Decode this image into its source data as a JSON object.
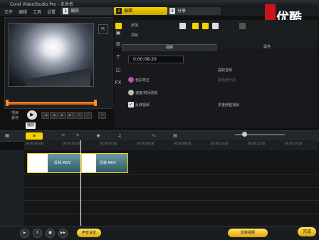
{
  "window": {
    "title": "Corel VideoStudio Pro - 未命名"
  },
  "menu": [
    "文件",
    "编辑",
    "工具",
    "设置"
  ],
  "steps": [
    {
      "n": "1",
      "label": "捕获"
    },
    {
      "n": "2",
      "label": "编辑"
    },
    {
      "n": "3",
      "label": "分享"
    }
  ],
  "logo": {
    "text": "优酷"
  },
  "preview": {
    "project_label": "项目",
    "clip_label": "素材",
    "play_tip": "播放"
  },
  "library": {
    "add_label": "添加",
    "folder_label": "项目"
  },
  "tabs": {
    "video": "视频",
    "attributes": "属性"
  },
  "options": {
    "duration": "0:00:08:20",
    "color_correction": "色彩校正",
    "speed": "速度/时间流逝",
    "reverse": "反转视频",
    "extract_audio": "提取音频",
    "split_scene": "按场景分割",
    "multi_trim": "多重修整视频"
  },
  "timeline": {
    "ruler": [
      "00:00:00:00",
      "00:00:02:00",
      "00:00:04:00",
      "00:00:06:00",
      "00:00:08:00",
      "00:00:10:00",
      "00:00:12:00",
      "00:00:14:00"
    ],
    "clips": [
      "反转.MOV",
      "反转.MOV"
    ]
  },
  "bottom": {
    "mix": "声音设定",
    "done": "完成",
    "render": "反转视频"
  }
}
